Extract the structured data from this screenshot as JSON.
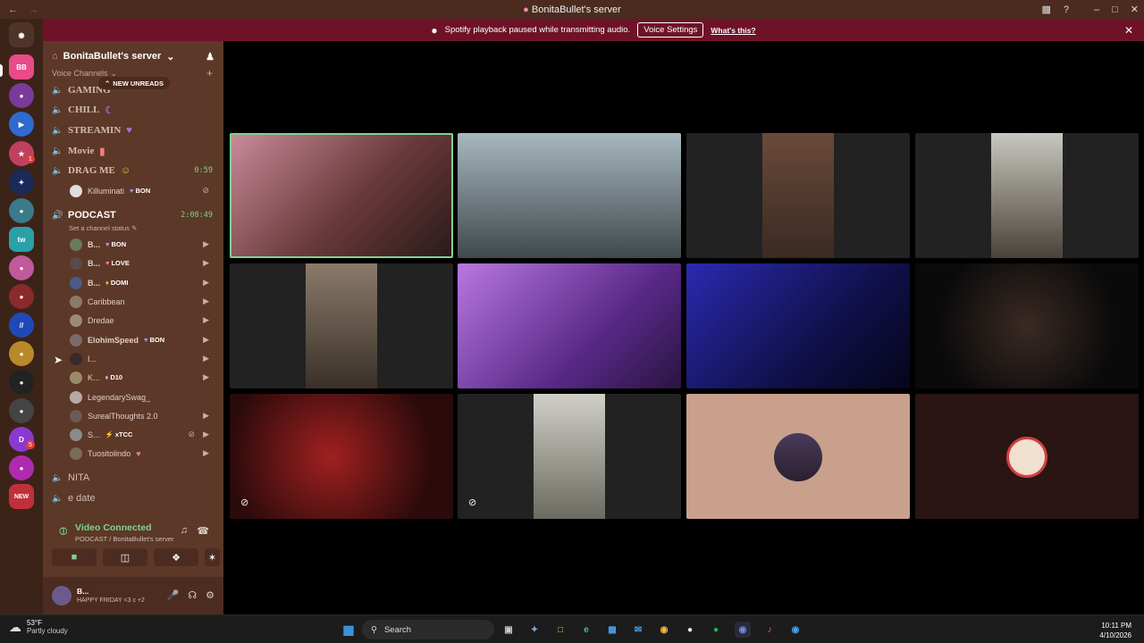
{
  "window": {
    "title": "BonitaBullet's server"
  },
  "banner": {
    "text": "Spotify playback paused while transmitting audio.",
    "voice_settings": "Voice Settings",
    "whats_this": "What's this?"
  },
  "server": {
    "name": "BonitaBullet's server"
  },
  "category": {
    "label": "Voice Channels"
  },
  "new_unreads": "NEW UNREADS",
  "channels": [
    {
      "name": "GAMING"
    },
    {
      "name": "CHILL"
    },
    {
      "name": "STREAMIN"
    },
    {
      "name": "Movie"
    },
    {
      "name": "DRAG ME",
      "timer": "0:59"
    },
    {
      "name": "PODCAST",
      "timer": "2:08:49",
      "status": "Set a channel status"
    },
    {
      "name": "NITA"
    },
    {
      "name": "e date"
    }
  ],
  "drag_me_user": {
    "name": "Killuminati",
    "tag": "BON"
  },
  "podcast_users": [
    {
      "name": "B...",
      "tag": "BON",
      "color": "#b98cf0"
    },
    {
      "name": "B...",
      "tag": "LOVE",
      "color": "#f07ab0"
    },
    {
      "name": "B...",
      "tag": "DOMI",
      "color": "#f0c040"
    },
    {
      "name": "Caribbean",
      "tag": ""
    },
    {
      "name": "Dredae",
      "tag": ""
    },
    {
      "name": "ElohimSpeed",
      "tag": "BON",
      "color": "#b98cf0"
    },
    {
      "name": "I...",
      "tag": ""
    },
    {
      "name": "K...",
      "tag": "D10",
      "color": "#c0c0ff"
    },
    {
      "name": "LegendarySwag_",
      "tag": ""
    },
    {
      "name": "SurealThoughts 2.0",
      "tag": ""
    },
    {
      "name": "S...",
      "tag": "xTCC",
      "color": "#9b8cff"
    },
    {
      "name": "Tuositolindo",
      "tag": ""
    }
  ],
  "voice": {
    "status": "Video Connected",
    "channel": "PODCAST / BonitaBullet's server"
  },
  "user": {
    "name": "B...",
    "status": "HAPPY FRIDAY <3 c +2"
  },
  "server_badges": {
    "new": "NEW",
    "b1": "1",
    "b5": "5"
  },
  "taskbar": {
    "temp": "53°F",
    "weather": "Partly cloudy",
    "search": "Search",
    "time": "10:11 PM",
    "date": "4/10/2026"
  },
  "colors": {
    "accent_green": "#7fd38f",
    "banner": "#6e1228",
    "sidebar": "#5c3828"
  }
}
